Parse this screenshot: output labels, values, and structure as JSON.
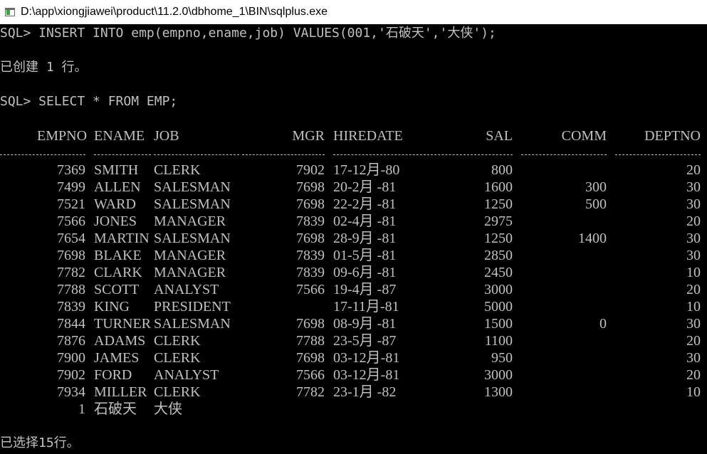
{
  "window": {
    "title": "D:\\app\\xiongjiawei\\product\\11.2.0\\dbhome_1\\BIN\\sqlplus.exe",
    "icon": "console-window-icon"
  },
  "colors": {
    "background": "#000000",
    "text": "#c0c0c0",
    "titlebar": "#ffffff"
  },
  "console": {
    "insert_command": "SQL> INSERT INTO emp(empno,ename,job) VALUES(001,'石破天','大侠');",
    "insert_result": "已创建 1 行。",
    "select_command": "SQL> SELECT * FROM EMP;",
    "footer": "已选择15行。"
  },
  "table": {
    "headers": {
      "empno": "EMPNO",
      "ename": "ENAME",
      "job": "JOB",
      "mgr": "MGR",
      "hiredate": "HIREDATE",
      "sal": "SAL",
      "comm": "COMM",
      "deptno": "DEPTNO"
    },
    "rows": [
      {
        "empno": "7369",
        "ename": "SMITH",
        "job": "CLERK",
        "mgr": "7902",
        "hiredate": "17-12月-80",
        "sal": "800",
        "comm": "",
        "deptno": "20"
      },
      {
        "empno": "7499",
        "ename": "ALLEN",
        "job": "SALESMAN",
        "mgr": "7698",
        "hiredate": "20-2月 -81",
        "sal": "1600",
        "comm": "300",
        "deptno": "30"
      },
      {
        "empno": "7521",
        "ename": "WARD",
        "job": "SALESMAN",
        "mgr": "7698",
        "hiredate": "22-2月 -81",
        "sal": "1250",
        "comm": "500",
        "deptno": "30"
      },
      {
        "empno": "7566",
        "ename": "JONES",
        "job": "MANAGER",
        "mgr": "7839",
        "hiredate": "02-4月 -81",
        "sal": "2975",
        "comm": "",
        "deptno": "20"
      },
      {
        "empno": "7654",
        "ename": "MARTIN",
        "job": "SALESMAN",
        "mgr": "7698",
        "hiredate": "28-9月 -81",
        "sal": "1250",
        "comm": "1400",
        "deptno": "30"
      },
      {
        "empno": "7698",
        "ename": "BLAKE",
        "job": "MANAGER",
        "mgr": "7839",
        "hiredate": "01-5月 -81",
        "sal": "2850",
        "comm": "",
        "deptno": "30"
      },
      {
        "empno": "7782",
        "ename": "CLARK",
        "job": "MANAGER",
        "mgr": "7839",
        "hiredate": "09-6月 -81",
        "sal": "2450",
        "comm": "",
        "deptno": "10"
      },
      {
        "empno": "7788",
        "ename": "SCOTT",
        "job": "ANALYST",
        "mgr": "7566",
        "hiredate": "19-4月 -87",
        "sal": "3000",
        "comm": "",
        "deptno": "20"
      },
      {
        "empno": "7839",
        "ename": "KING",
        "job": "PRESIDENT",
        "mgr": "",
        "hiredate": "17-11月-81",
        "sal": "5000",
        "comm": "",
        "deptno": "10"
      },
      {
        "empno": "7844",
        "ename": "TURNER",
        "job": "SALESMAN",
        "mgr": "7698",
        "hiredate": "08-9月 -81",
        "sal": "1500",
        "comm": "0",
        "deptno": "30"
      },
      {
        "empno": "7876",
        "ename": "ADAMS",
        "job": "CLERK",
        "mgr": "7788",
        "hiredate": "23-5月 -87",
        "sal": "1100",
        "comm": "",
        "deptno": "20"
      },
      {
        "empno": "7900",
        "ename": "JAMES",
        "job": "CLERK",
        "mgr": "7698",
        "hiredate": "03-12月-81",
        "sal": "950",
        "comm": "",
        "deptno": "30"
      },
      {
        "empno": "7902",
        "ename": "FORD",
        "job": "ANALYST",
        "mgr": "7566",
        "hiredate": "03-12月-81",
        "sal": "3000",
        "comm": "",
        "deptno": "20"
      },
      {
        "empno": "7934",
        "ename": "MILLER",
        "job": "CLERK",
        "mgr": "7782",
        "hiredate": "23-1月 -82",
        "sal": "1300",
        "comm": "",
        "deptno": "10"
      },
      {
        "empno": "1",
        "ename": "石破天",
        "job": "大侠",
        "mgr": "",
        "hiredate": "",
        "sal": "",
        "comm": "",
        "deptno": ""
      }
    ]
  }
}
